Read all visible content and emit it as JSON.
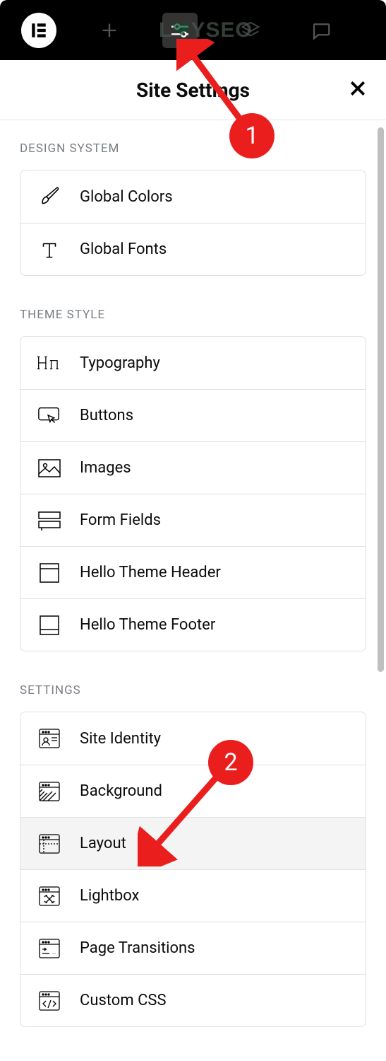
{
  "header": {
    "title": "Site Settings"
  },
  "watermark": "LOYSEO",
  "sections": [
    {
      "label": "DESIGN SYSTEM",
      "items": [
        {
          "label": "Global Colors",
          "icon": "brush-icon"
        },
        {
          "label": "Global Fonts",
          "icon": "type-icon"
        }
      ]
    },
    {
      "label": "THEME STYLE",
      "items": [
        {
          "label": "Typography",
          "icon": "heading-icon"
        },
        {
          "label": "Buttons",
          "icon": "cursor-icon"
        },
        {
          "label": "Images",
          "icon": "image-icon"
        },
        {
          "label": "Form Fields",
          "icon": "form-icon"
        },
        {
          "label": "Hello Theme Header",
          "icon": "header-icon"
        },
        {
          "label": "Hello Theme Footer",
          "icon": "footer-icon"
        }
      ]
    },
    {
      "label": "SETTINGS",
      "items": [
        {
          "label": "Site Identity",
          "icon": "identity-icon"
        },
        {
          "label": "Background",
          "icon": "background-icon"
        },
        {
          "label": "Layout",
          "icon": "layout-icon",
          "highlighted": true
        },
        {
          "label": "Lightbox",
          "icon": "lightbox-icon"
        },
        {
          "label": "Page Transitions",
          "icon": "transitions-icon"
        },
        {
          "label": "Custom CSS",
          "icon": "css-icon"
        }
      ]
    }
  ],
  "annotations": [
    {
      "number": "1"
    },
    {
      "number": "2"
    }
  ]
}
